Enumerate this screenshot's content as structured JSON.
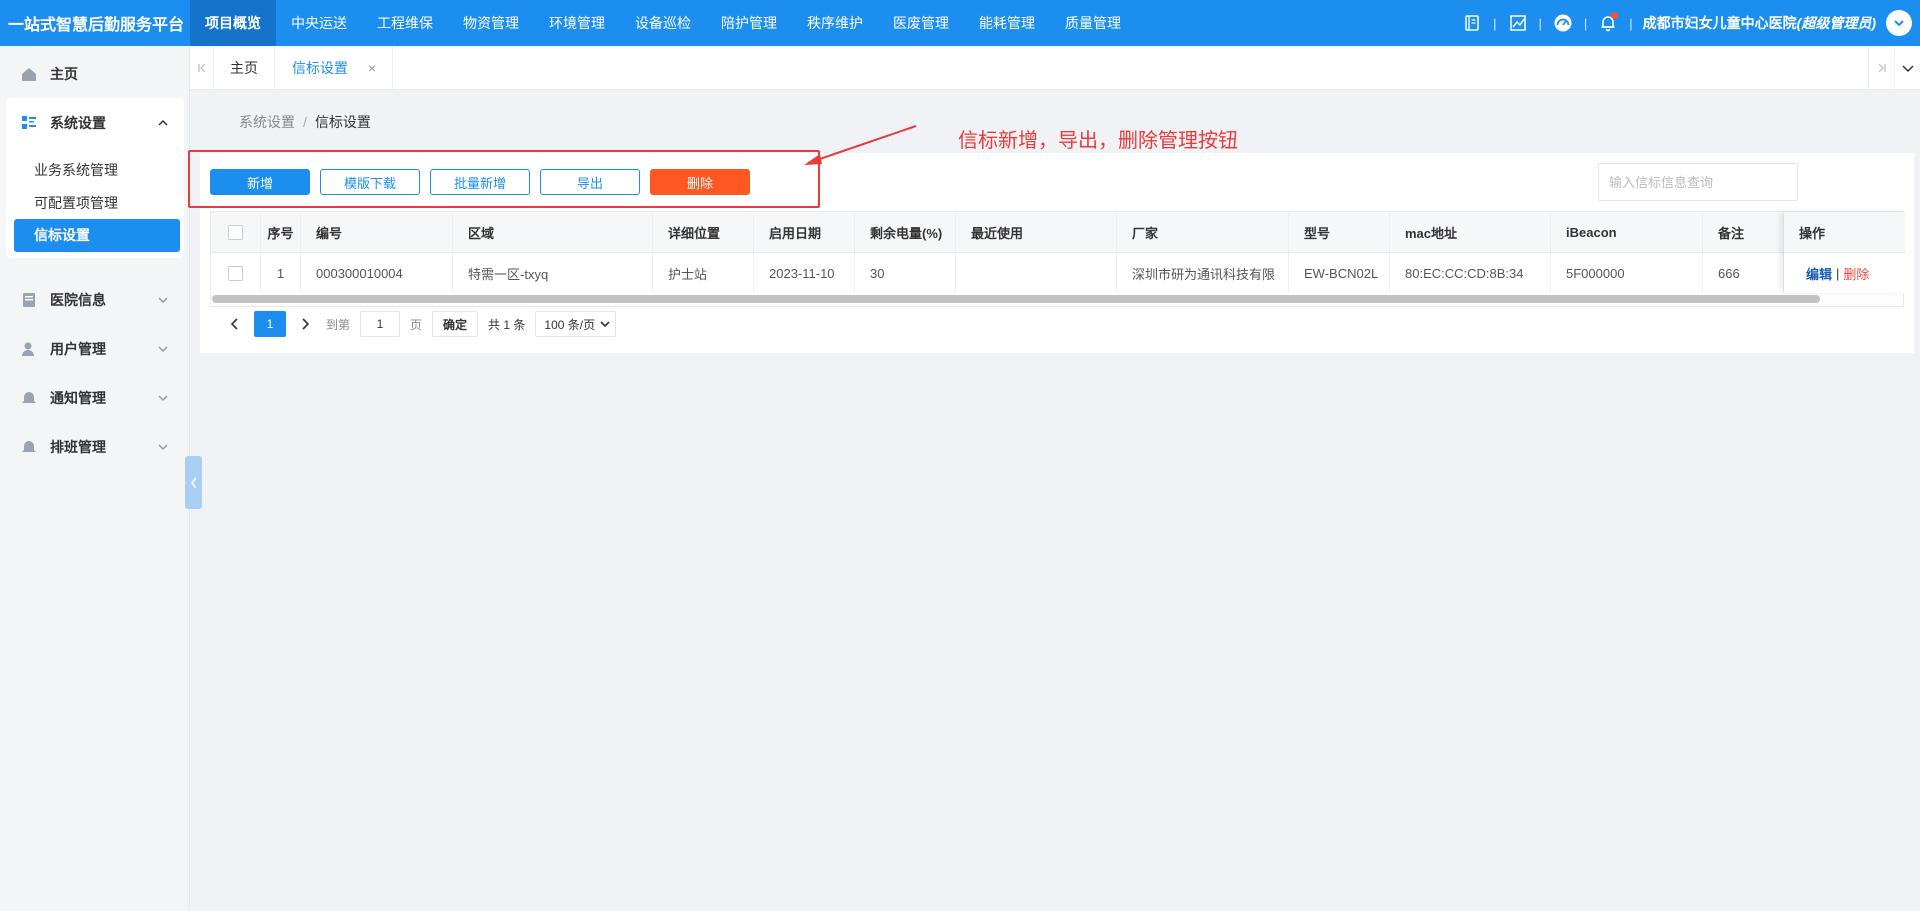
{
  "app": {
    "title": "一站式智慧后勤服务平台",
    "nav": [
      "项目概览",
      "中央运送",
      "工程维保",
      "物资管理",
      "环境管理",
      "设备巡检",
      "陪护管理",
      "秩序维护",
      "医废管理",
      "能耗管理",
      "质量管理"
    ],
    "user_hospital": "成都市妇女儿童中心医院",
    "user_role": "(超级管理员)",
    "brand_color": "#1b8ef0"
  },
  "sidebar": {
    "home": "主页",
    "system": "系统设置",
    "sub_items": [
      "业务系统管理",
      "可配置项管理",
      "信标设置"
    ],
    "groups": [
      "医院信息",
      "用户管理",
      "通知管理",
      "排班管理"
    ]
  },
  "tabs": {
    "home": "主页",
    "active": "信标设置",
    "close": "×"
  },
  "breadcrumb": {
    "parent": "系统设置",
    "sep": "/",
    "current": "信标设置"
  },
  "toolbar": {
    "add": "新增",
    "template_download": "模版下载",
    "batch_add": "批量新增",
    "export": "导出",
    "delete": "删除",
    "search_placeholder": "输入信标信息查询"
  },
  "annotation": {
    "text": "信标新增，导出，删除管理按钮",
    "color": "#e83b3b"
  },
  "table": {
    "headers": [
      "序号",
      "编号",
      "区域",
      "详细位置",
      "启用日期",
      "剩余电量(%)",
      "最近使用",
      "厂家",
      "型号",
      "mac地址",
      "iBeacon",
      "备注",
      "操作"
    ],
    "rows": [
      [
        "1",
        "000300010004",
        "特需一区-txyq",
        "护士站",
        "2023-11-10",
        "30",
        "",
        "深圳市研为通讯科技有限",
        "EW-BCN02L",
        "80:EC:CC:CD:8B:34",
        "5F000000",
        "666"
      ]
    ],
    "op_edit": "编辑",
    "op_sep": "|",
    "op_delete": "删除"
  },
  "pagination": {
    "current_page": "1",
    "goto_label": "到第",
    "goto_value": "1",
    "page_unit": "页",
    "confirm": "确定",
    "total": "共 1 条",
    "page_size": "100 条/页"
  }
}
